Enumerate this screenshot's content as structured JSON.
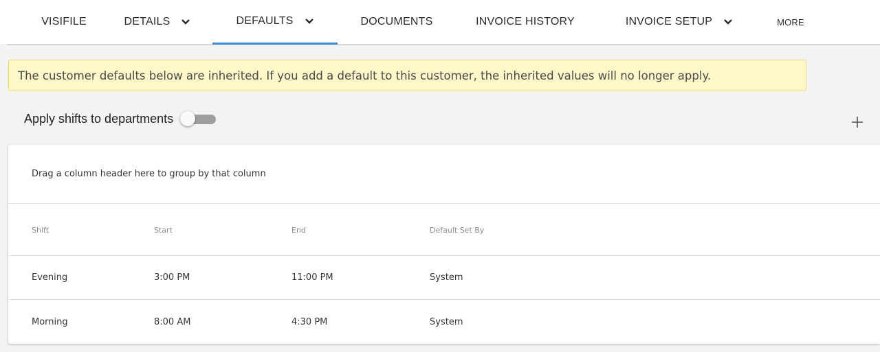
{
  "tabs": [
    {
      "label": "VISIFILE",
      "has_dropdown": false
    },
    {
      "label": "DETAILS",
      "has_dropdown": true
    },
    {
      "label": "DEFAULTS",
      "has_dropdown": true,
      "active": true
    },
    {
      "label": "DOCUMENTS",
      "has_dropdown": false
    },
    {
      "label": "INVOICE HISTORY",
      "has_dropdown": false
    },
    {
      "label": "INVOICE SETUP",
      "has_dropdown": true
    },
    {
      "label": "MORE",
      "has_dropdown": false
    }
  ],
  "colors": {
    "active_tab_underline": "#3b8fd6",
    "banner_background": "#fef7c8",
    "banner_border": "#efd976",
    "toggle_off": "#9e9e9e"
  },
  "banner": {
    "message": "The customer defaults below are inherited. If you add a default to this customer, the inherited values will no longer apply."
  },
  "apply_shifts": {
    "label": "Apply shifts to departments",
    "enabled": false
  },
  "icons": {
    "add": "plus-icon",
    "dropdown": "chevron-down-icon"
  },
  "grid": {
    "group_panel_text": "Drag a column header here to group by that column",
    "columns": [
      "Shift",
      "Start",
      "End",
      "Default Set By"
    ],
    "rows": [
      {
        "shift": "Evening",
        "start": "3:00 PM",
        "end": "11:00 PM",
        "default_set_by": "System"
      },
      {
        "shift": "Morning",
        "start": "8:00 AM",
        "end": "4:30 PM",
        "default_set_by": "System"
      }
    ]
  }
}
